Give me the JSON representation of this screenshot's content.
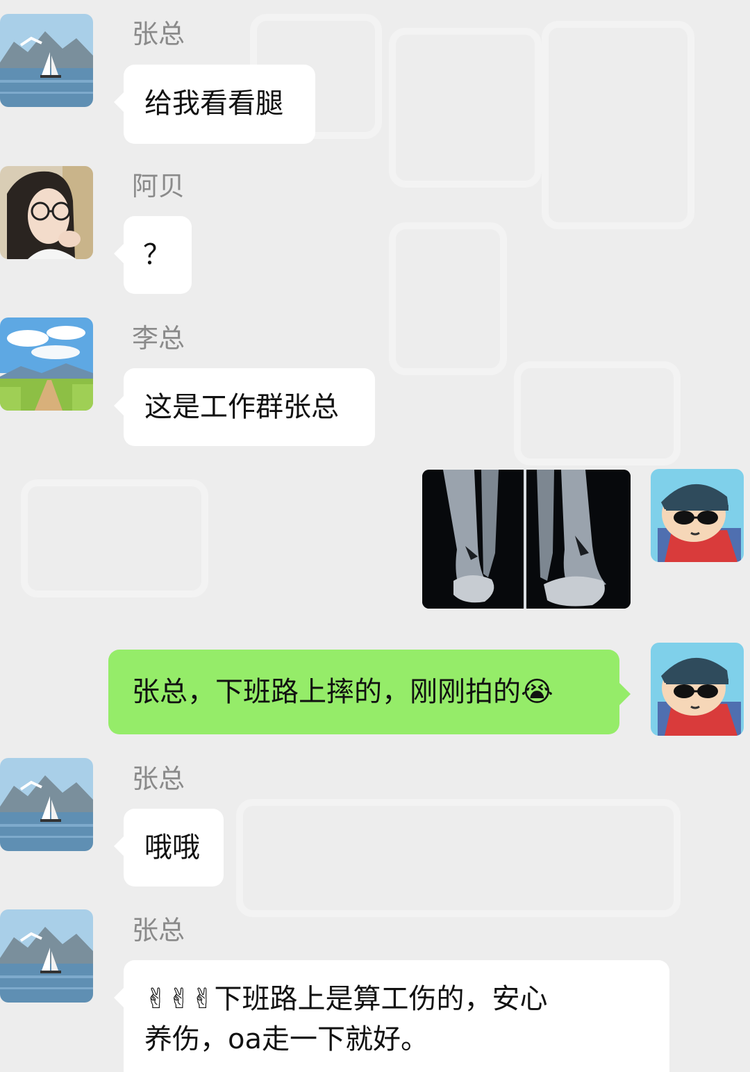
{
  "messages": [
    {
      "sender": "张总",
      "text": "给我看看腿"
    },
    {
      "sender": "阿贝",
      "text": "？"
    },
    {
      "sender": "李总",
      "text": "这是工作群张总"
    },
    {
      "sender": "me",
      "text": "张总，下班路上摔的，刚刚拍的",
      "emoji": "😭"
    },
    {
      "sender": "张总",
      "text": "哦哦"
    },
    {
      "sender": "张总",
      "text_line1": "下班路上是算工伤的，安心",
      "text_line2": "养伤，oa走一下就好。",
      "emoji": "✌✌✌"
    }
  ],
  "colors": {
    "background": "#ededed",
    "incoming_bubble": "#ffffff",
    "outgoing_bubble": "#95ec69",
    "name_text": "#8a8a8a"
  },
  "icons": {
    "avatar_zhang": "sailboat-lake-avatar",
    "avatar_abei": "girl-glasses-avatar",
    "avatar_li": "country-road-avatar",
    "avatar_me": "cartoon-boy-sunglasses-avatar",
    "image_message": "leg-xray-image"
  }
}
